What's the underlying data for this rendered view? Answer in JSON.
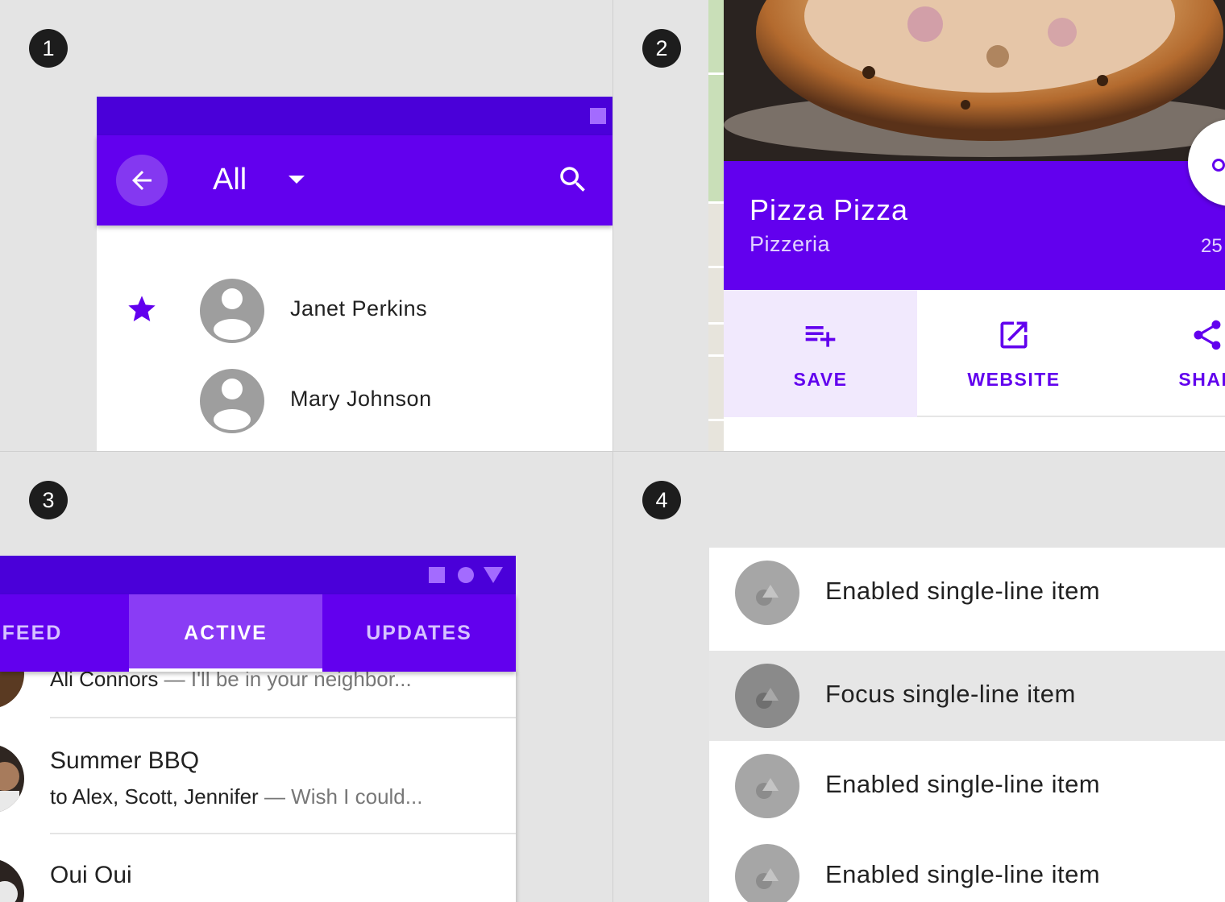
{
  "panels": {
    "one": {
      "number": "1",
      "appbar": {
        "title": "All"
      },
      "contacts": [
        {
          "name": "Janet Perkins",
          "starred": true
        },
        {
          "name": "Mary Johnson",
          "starred": false
        }
      ]
    },
    "two": {
      "number": "2",
      "place": {
        "title": "Pizza Pizza",
        "subtitle": "Pizzeria",
        "distance": "25"
      },
      "actions": [
        {
          "label": "SAVE",
          "icon": "playlist-add-icon",
          "selected": true
        },
        {
          "label": "WEBSITE",
          "icon": "open-in-new-icon",
          "selected": false
        },
        {
          "label": "SHAR",
          "icon": "share-icon",
          "selected": false
        }
      ]
    },
    "three": {
      "number": "3",
      "tabs": [
        {
          "label": "FEED",
          "active": false
        },
        {
          "label": "ACTIVE",
          "active": true
        },
        {
          "label": "UPDATES",
          "active": false
        }
      ],
      "messages": [
        {
          "sender": "Ali Connors",
          "preview": "— I'll be in your neighbor..."
        },
        {
          "title": "Summer BBQ",
          "recipients": "to Alex, Scott, Jennifer",
          "preview": "— Wish I could..."
        },
        {
          "title": "Oui Oui"
        }
      ]
    },
    "four": {
      "number": "4",
      "items": [
        {
          "label": "Enabled single-line item",
          "state": "enabled"
        },
        {
          "label": "Focus single-line item",
          "state": "focus"
        },
        {
          "label": "Enabled single-line item",
          "state": "enabled"
        },
        {
          "label": "Enabled single-line item",
          "state": "enabled"
        }
      ]
    }
  },
  "colors": {
    "primary": "#6200ee",
    "primary_dark": "#4a00d9",
    "background": "#e4e4e4"
  }
}
